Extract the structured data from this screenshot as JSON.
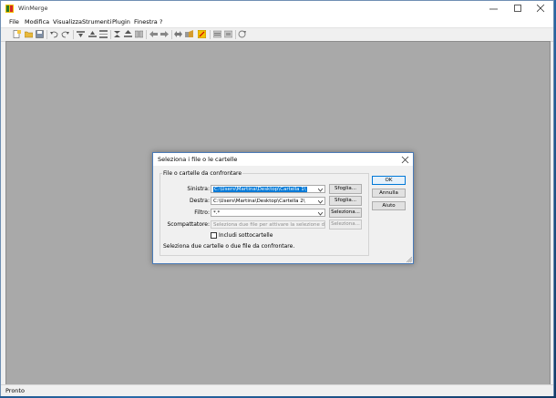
{
  "window": {
    "title": "WinMerge",
    "controls": [
      "minimize-icon",
      "maximize-icon",
      "close-icon"
    ]
  },
  "menu": {
    "items": [
      "File",
      "Modifica",
      "Visualizza",
      "Strumenti",
      "Plugin",
      "Finestra",
      "?"
    ]
  },
  "toolbar": {
    "icons": [
      "new-icon",
      "open-icon",
      "save-icon",
      "undo-icon",
      "redo-icon",
      "next-diff-icon",
      "prev-diff-icon",
      "first-diff-icon",
      "current-diff-icon",
      "last-diff-icon",
      "copy-left-icon",
      "copy-right-icon",
      "merge-icon",
      "all-left-icon",
      "options-icon",
      "settings-icon",
      "refresh-icon",
      "zoom-icon"
    ]
  },
  "status": {
    "text": "Pronto"
  },
  "dialog": {
    "title": "Seleziona i file o le cartelle",
    "group_label": "File o cartelle da confrontare",
    "left": {
      "label": "Sinistra:",
      "value": "C:\\Users\\Martina\\Desktop\\Cartella 1\\",
      "button": "Sfoglia..."
    },
    "right": {
      "label": "Destra:",
      "value": "C:\\Users\\Martina\\Desktop\\Cartella 2\\",
      "button": "Sfoglia..."
    },
    "filter": {
      "label": "Filtro:",
      "value": "*.*",
      "button": "Seleziona..."
    },
    "unpacker": {
      "label": "Scompattatore:",
      "placeholder": "Seleziona due file per attivare la selezione dello sc:",
      "button": "Seleziona..."
    },
    "include_subfolders": {
      "label": "Includi sottocartelle",
      "checked": false
    },
    "hint": "Seleziona due cartelle o due file da confrontare.",
    "buttons": {
      "ok": "OK",
      "cancel": "Annulla",
      "help": "Aiuto"
    }
  },
  "colors": {
    "workspace": "#a9a9a9",
    "selection": "#0078d7",
    "dialog_border": "#4a7bb8"
  }
}
